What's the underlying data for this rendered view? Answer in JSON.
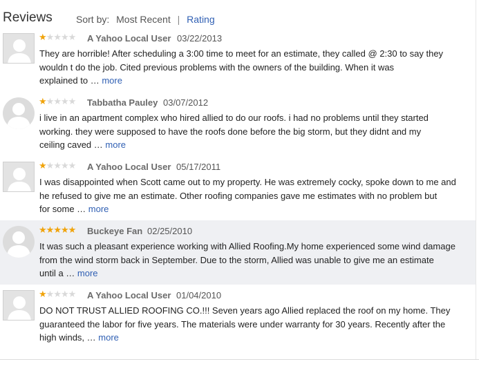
{
  "header": {
    "title": "Reviews",
    "sort_label": "Sort by:",
    "sort_most_recent": "Most Recent",
    "sort_separator": "|",
    "sort_rating": "Rating"
  },
  "colors": {
    "star_on": "#f0a30a",
    "star_off": "#d9d9d9",
    "link": "#2f5fb3",
    "highlight_bg": "#eff0f3"
  },
  "reviews": [
    {
      "rating": 1,
      "author": "A Yahoo Local User",
      "date": "03/22/2013",
      "text_lines": [
        "They are horrible! After scheduling a 3:00 time to meet for an estimate, they called @ 2:30 to say they",
        "wouldn t do the job. Cited previous problems with the owners of the building. When it was",
        "explained to … "
      ],
      "more": "more",
      "avatar_icon": "default-user-icon"
    },
    {
      "rating": 1,
      "author": "Tabbatha Pauley",
      "date": "03/07/2012",
      "text_lines": [
        "i live in an apartment complex who hired allied to do our roofs. i had no problems until they started",
        "working. they were supposed to have the roofs done before the big storm, but they didnt and my",
        "ceiling caved … "
      ],
      "more": "more",
      "avatar_icon": "round-user-icon"
    },
    {
      "rating": 1,
      "author": "A Yahoo Local User",
      "date": "05/17/2011",
      "text_lines": [
        "I was disappointed when Scott came out to my property. He was extremely cocky, spoke down to me and",
        "he refused to give me an estimate. Other roofing companies gave me estimates with no problem but",
        "for some … "
      ],
      "more": "more",
      "avatar_icon": "default-user-icon"
    },
    {
      "rating": 5,
      "author": "Buckeye Fan",
      "date": "02/25/2010",
      "text_lines": [
        "It was such a pleasant experience working with Allied Roofing.My home experienced some wind damage",
        "from the wind storm back in September. Due to the storm, Allied was unable to give me an estimate",
        "until a … "
      ],
      "more": "more",
      "avatar_icon": "round-user-icon"
    },
    {
      "rating": 1,
      "author": "A Yahoo Local User",
      "date": "01/04/2010",
      "text_lines": [
        "DO NOT TRUST ALLIED ROOFING CO.!!! Seven years ago Allied replaced the roof on my home. They",
        "guaranteed the labor for five years. The materials were under warranty for 30 years. Recently after the",
        "high winds, … "
      ],
      "more": "more",
      "avatar_icon": "default-user-icon"
    }
  ]
}
